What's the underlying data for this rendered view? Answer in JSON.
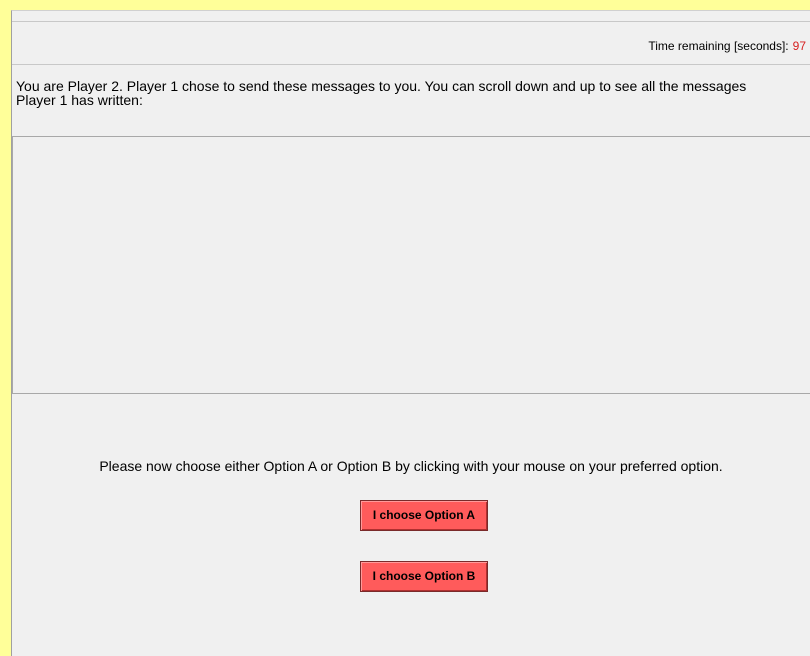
{
  "header": {
    "timer_label": "Time remaining [seconds]:",
    "timer_value": "97"
  },
  "main": {
    "instruction": "You are Player 2. Player 1 chose to send these messages to you. You can scroll down and up to see all the messages Player 1 has written:",
    "messages": "",
    "choose_prompt": "Please now choose either Option A or Option B by clicking with your mouse on your preferred option.",
    "option_a_label": "I choose Option A",
    "option_b_label": "I choose Option B"
  },
  "colors": {
    "frame_border": "#ffff99",
    "background": "#f0f0f0",
    "button": "#ff5b5b",
    "timer_value": "#d62020"
  }
}
